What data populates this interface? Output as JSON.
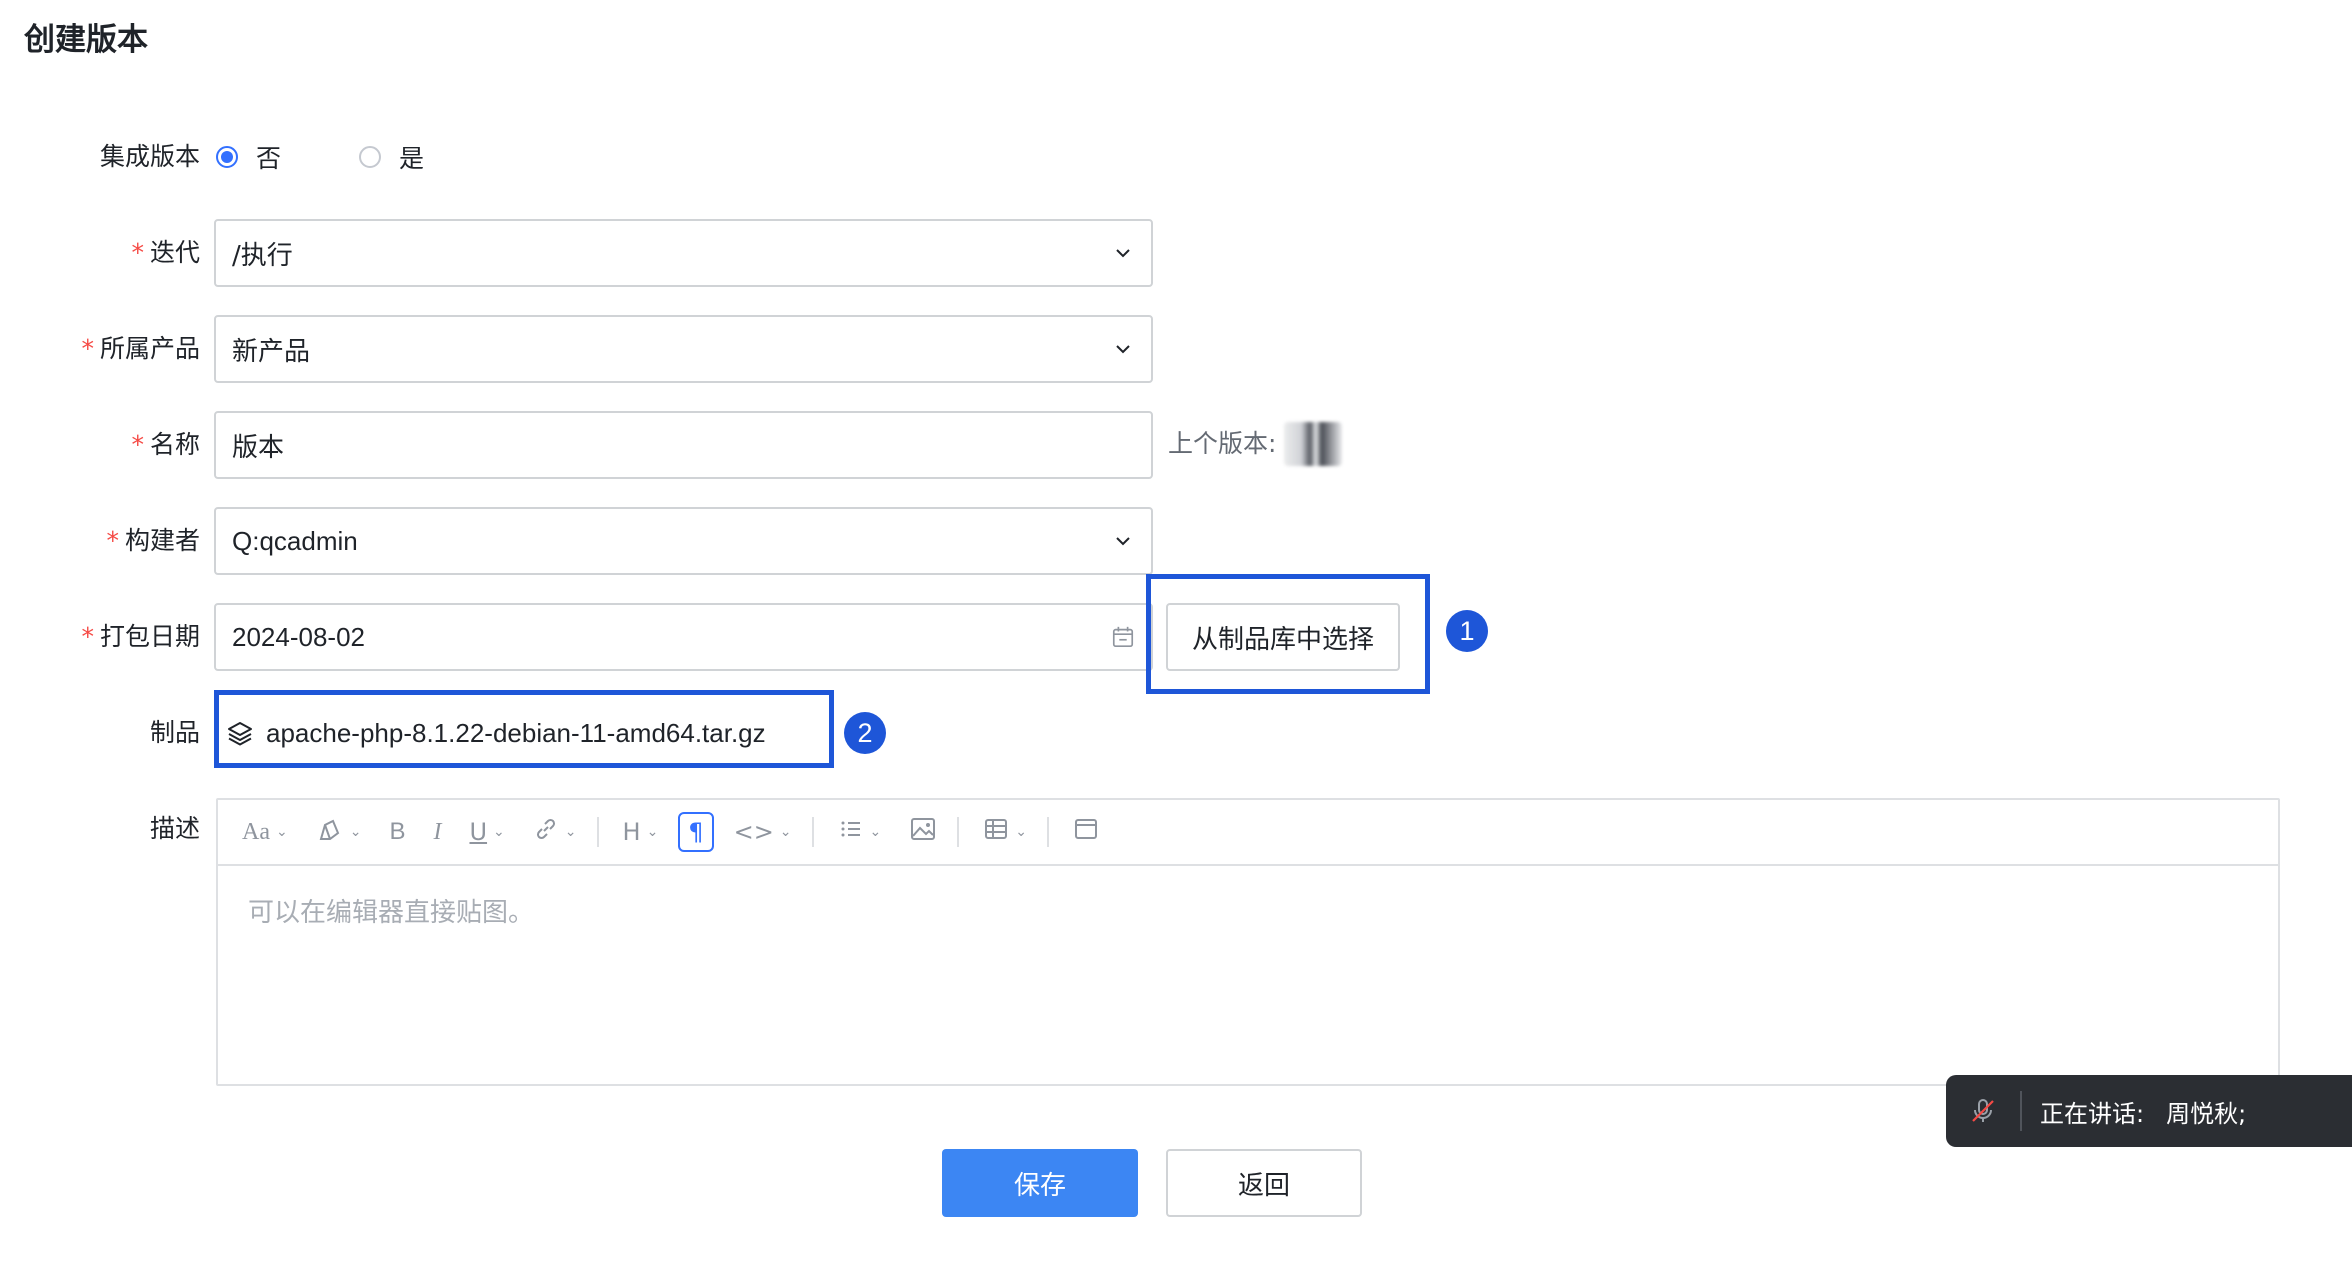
{
  "page": {
    "title": "创建版本"
  },
  "form": {
    "integrated": {
      "label": "集成版本",
      "options": [
        {
          "label": "否",
          "checked": true
        },
        {
          "label": "是",
          "checked": false
        }
      ]
    },
    "iteration": {
      "label": "迭代",
      "value": "/执行",
      "required": true
    },
    "product": {
      "label": "所属产品",
      "value": "新产品",
      "required": true
    },
    "name": {
      "label": "名称",
      "value": "版本",
      "required": true,
      "previous_version_label": "上个版本:"
    },
    "builder": {
      "label": "构建者",
      "value": "Q:qcadmin",
      "required": true
    },
    "pack_date": {
      "label": "打包日期",
      "value": "2024-08-02",
      "required": true
    },
    "select_from_repo_button": "从制品库中选择",
    "artifact": {
      "label": "制品",
      "value": "apache-php-8.1.22-debian-11-amd64.tar.gz"
    },
    "description": {
      "label": "描述",
      "placeholder": "可以在编辑器直接贴图。"
    },
    "required_mark": "*"
  },
  "annotations": {
    "badge_1": "1",
    "badge_2": "2",
    "box_color": "#1e56d8"
  },
  "editor_toolbar": {
    "items": [
      "font-size",
      "format-painter",
      "bold",
      "italic",
      "underline",
      "link",
      "heading",
      "paragraph",
      "code",
      "list",
      "image",
      "table",
      "layout"
    ],
    "font_size_label": "Aa",
    "bold_label": "B",
    "italic_label": "I",
    "underline_label": "U",
    "heading_label": "H",
    "paragraph_label": "¶",
    "code_label": "<>",
    "active_item": "paragraph"
  },
  "actions": {
    "save": "保存",
    "back": "返回"
  },
  "toast": {
    "speaking_label": "正在讲话:",
    "speaker": "周悦秋;"
  },
  "colors": {
    "primary": "#3c86f3",
    "required": "#f54a45",
    "accent": "#3370ff"
  }
}
